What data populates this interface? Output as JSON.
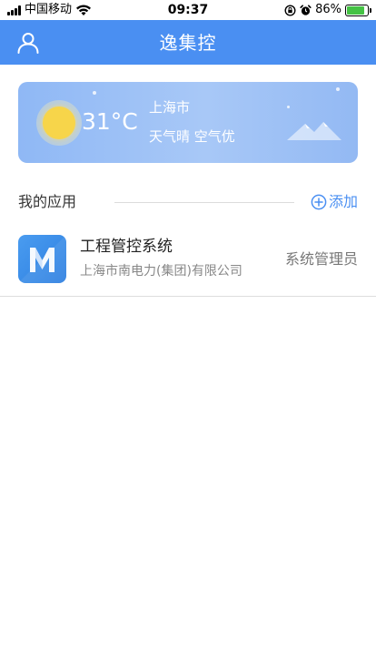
{
  "status_bar": {
    "carrier": "中国移动",
    "time": "09:37",
    "battery_text": "86%",
    "battery_level": 0.86,
    "signal_bars": 4,
    "icons": [
      "signal-icon",
      "wifi-icon",
      "orientation-lock-icon",
      "alarm-icon",
      "battery-icon"
    ]
  },
  "nav": {
    "title": "逸集控",
    "left_icon": "user-icon"
  },
  "weather": {
    "temperature": "31°C",
    "city": "上海市",
    "description": "天气晴 空气优",
    "icon": "sun-icon",
    "decoration_icon": "mountain-icon"
  },
  "my_apps": {
    "title": "我的应用",
    "add_label": "添加",
    "add_icon": "plus-circle-icon",
    "items": [
      {
        "name": "工程管控系统",
        "company": "上海市南电力(集团)有限公司",
        "role": "系统管理员",
        "icon": "m-app-icon"
      }
    ]
  },
  "colors": {
    "primary": "#4a8ff2",
    "weather_card": "#a8c8f7",
    "sun": "#f7d54a",
    "text_dark": "#222222",
    "text_muted": "#888888",
    "battery_green": "#44c244"
  }
}
